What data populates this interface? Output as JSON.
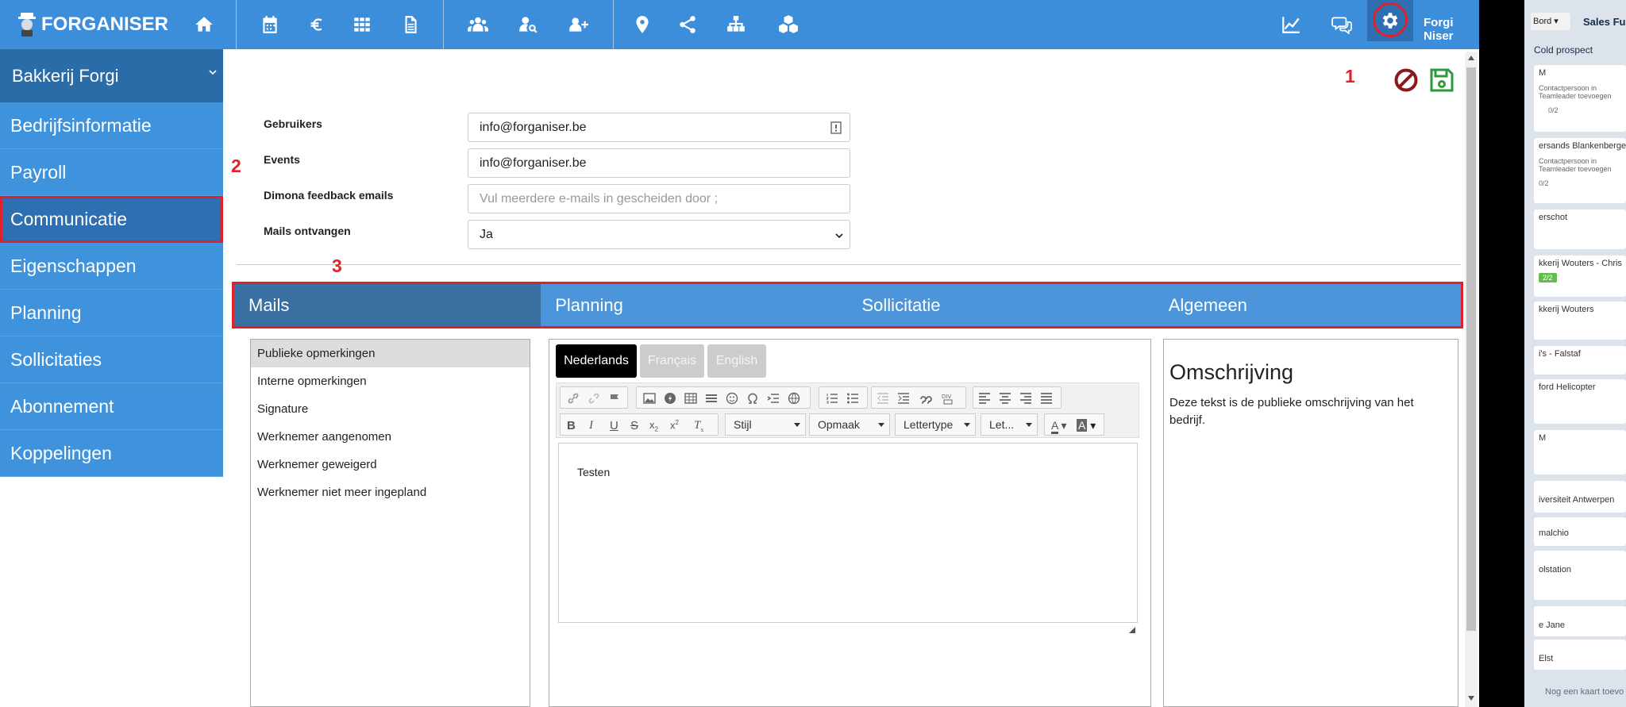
{
  "app": {
    "logo_text": "FORGANISER",
    "user_name": "Forgi Niser"
  },
  "topbar_icons": [
    "home-icon",
    "calendar-icon",
    "euro-icon",
    "grid-icon",
    "document-icon",
    "users-icon",
    "user-search-icon",
    "user-add-icon",
    "location-pin-icon",
    "share-icon",
    "org-chart-icon",
    "cubes-icon",
    "line-chart-icon",
    "chat-icon",
    "gear-icon",
    "hamburger-menu-icon"
  ],
  "sidebar": {
    "company": "Bakkerij Forgi",
    "items": [
      {
        "label": "Bedrijfsinformatie"
      },
      {
        "label": "Payroll"
      },
      {
        "label": "Communicatie"
      },
      {
        "label": "Eigenschappen"
      },
      {
        "label": "Planning"
      },
      {
        "label": "Sollicitaties"
      },
      {
        "label": "Abonnement"
      },
      {
        "label": "Koppelingen"
      }
    ]
  },
  "annotations": {
    "one": "1",
    "two": "2",
    "three": "3"
  },
  "form": {
    "gebruikers_label": "Gebruikers",
    "gebruikers_value": "info@forganiser.be",
    "events_label": "Events",
    "events_value": "info@forganiser.be",
    "dimona_label": "Dimona feedback emails",
    "dimona_placeholder": "Vul meerdere e-mails in gescheiden door ;",
    "mails_label": "Mails ontvangen",
    "mails_value": "Ja"
  },
  "tabs": [
    {
      "label": "Mails"
    },
    {
      "label": "Planning"
    },
    {
      "label": "Sollicitatie"
    },
    {
      "label": "Algemeen"
    }
  ],
  "mail_types": [
    "Publieke opmerkingen",
    "Interne opmerkingen",
    "Signature",
    "Werknemer aangenomen",
    "Werknemer geweigerd",
    "Werknemer niet meer ingepland"
  ],
  "editor": {
    "languages": [
      "Nederlands",
      "Français",
      "English"
    ],
    "dropdowns": [
      "Stijl",
      "Opmaak",
      "Lettertype",
      "Let..."
    ],
    "content": "Testen"
  },
  "description": {
    "title": "Omschrijving",
    "text": "Deze tekst is de publieke omschrijving van het bedrijf."
  },
  "board": {
    "view": "Bord",
    "title": "Sales Fu",
    "column": "Cold prospect",
    "cards": [
      {
        "title": "M",
        "sub": "Contactpersoon in Teamleader toevoegen",
        "meta": "0/2"
      },
      {
        "title": "ersands Blankenberge",
        "sub": "Contactpersoon in Teamleader toevoegen",
        "meta": "0/2"
      },
      {
        "title": "erschot",
        "sub": "",
        "meta": ""
      },
      {
        "title": "kkerij Wouters - Chris",
        "sub": "",
        "meta": "2/2"
      },
      {
        "title": "kkerij Wouters",
        "sub": "",
        "meta": ""
      },
      {
        "title": "i's - Falstaf",
        "sub": "",
        "meta": ""
      },
      {
        "title": "ford Helicopter",
        "sub": "",
        "meta": ""
      },
      {
        "title": "M",
        "sub": "",
        "meta": ""
      },
      {
        "title": "iversiteit Antwerpen",
        "sub": "",
        "meta": ""
      },
      {
        "title": "malchio",
        "sub": "",
        "meta": ""
      },
      {
        "title": "olstation",
        "sub": "",
        "meta": ""
      },
      {
        "title": "e Jane",
        "sub": "",
        "meta": ""
      },
      {
        "title": "Elst",
        "sub": "",
        "meta": ""
      }
    ],
    "add_card": "Nog een kaart toevo"
  },
  "colors": {
    "primary": "#3c8edb",
    "dark": "#2d6fb0",
    "highlight": "#e0202a",
    "save": "#2e9a3b",
    "cancel": "#8b1a1a"
  }
}
